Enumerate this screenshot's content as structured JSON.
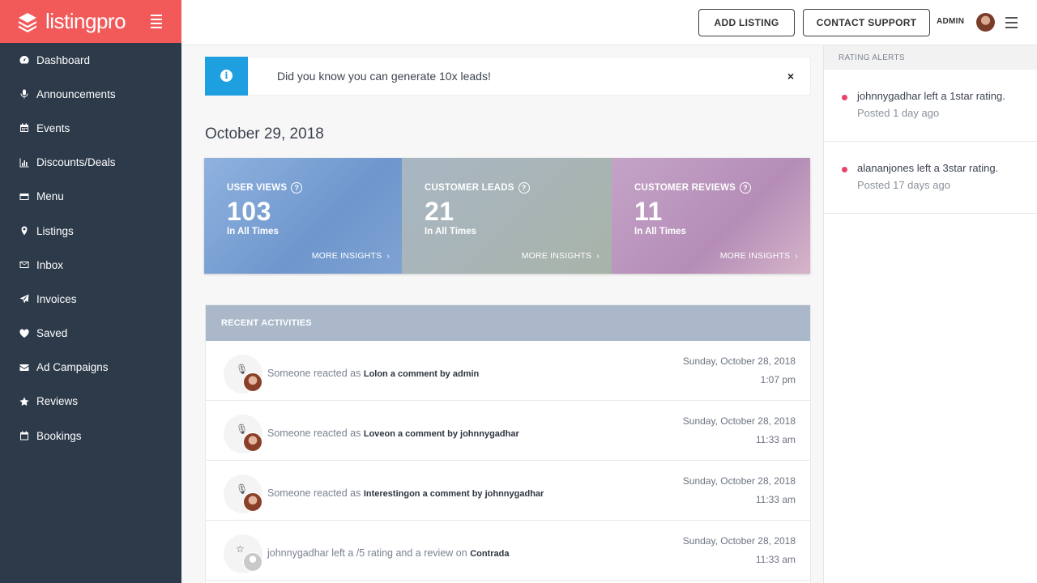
{
  "brand": {
    "name": "listingpro"
  },
  "sidebar": {
    "items": [
      {
        "label": "Dashboard",
        "icon": "dashboard-icon"
      },
      {
        "label": "Announcements",
        "icon": "microphone-icon"
      },
      {
        "label": "Events",
        "icon": "calendar-icon"
      },
      {
        "label": "Discounts/Deals",
        "icon": "bar-chart-icon"
      },
      {
        "label": "Menu",
        "icon": "card-icon"
      },
      {
        "label": "Listings",
        "icon": "map-pin-icon"
      },
      {
        "label": "Inbox",
        "icon": "envelope-icon"
      },
      {
        "label": "Invoices",
        "icon": "paper-plane-icon"
      },
      {
        "label": "Saved",
        "icon": "heart-icon"
      },
      {
        "label": "Ad Campaigns",
        "icon": "envelope-filled-icon"
      },
      {
        "label": "Reviews",
        "icon": "star-icon"
      },
      {
        "label": "Bookings",
        "icon": "calendar-outline-icon"
      }
    ]
  },
  "header": {
    "add_listing": "ADD LISTING",
    "contact_support": "CONTACT SUPPORT",
    "admin": "ADMIN"
  },
  "alert": {
    "text": "Did you know you can generate 10x leads!",
    "close": "×",
    "accent": "#1d9fe0"
  },
  "date_heading": "October 29, 2018",
  "stats": [
    {
      "label": "USER VIEWS",
      "value": "103",
      "sub": "In All Times",
      "more": "MORE INSIGHTS"
    },
    {
      "label": "CUSTOMER LEADS",
      "value": "21",
      "sub": "In All Times",
      "more": "MORE INSIGHTS"
    },
    {
      "label": "CUSTOMER REVIEWS",
      "value": "11",
      "sub": "In All Times",
      "more": "MORE INSIGHTS"
    }
  ],
  "activities": {
    "title": "RECENT ACTIVITIES",
    "items": [
      {
        "prefix": "Someone reacted as",
        "bold": "Lolon a comment by admin",
        "date": "Sunday, October 28, 2018",
        "time": "1:07 pm",
        "icon": "microphone-icon"
      },
      {
        "prefix": "Someone reacted as",
        "bold": "Loveon a comment by johnnygadhar",
        "date": "Sunday, October 28, 2018",
        "time": "11:33 am",
        "icon": "microphone-icon"
      },
      {
        "prefix": "Someone reacted as",
        "bold": "Interestingon a comment by johnnygadhar",
        "date": "Sunday, October 28, 2018",
        "time": "11:33 am",
        "icon": "microphone-icon"
      },
      {
        "prefix": "johnnygadhar left a /5 rating and a review on",
        "bold": "Contrada",
        "date": "Sunday, October 28, 2018",
        "time": "11:33 am",
        "icon": "star-outline-icon"
      }
    ]
  },
  "rating_alerts": {
    "title": "RATING ALERTS",
    "items": [
      {
        "text": "johnnygadhar left a 1star rating.",
        "time": "Posted 1 day ago"
      },
      {
        "text": "alananjones left a 3star rating.",
        "time": "Posted 17 days ago"
      }
    ]
  },
  "colors": {
    "brand": "#f25a5a",
    "sidebar": "#2d3a4a",
    "alert_dot": "#e8446a"
  }
}
